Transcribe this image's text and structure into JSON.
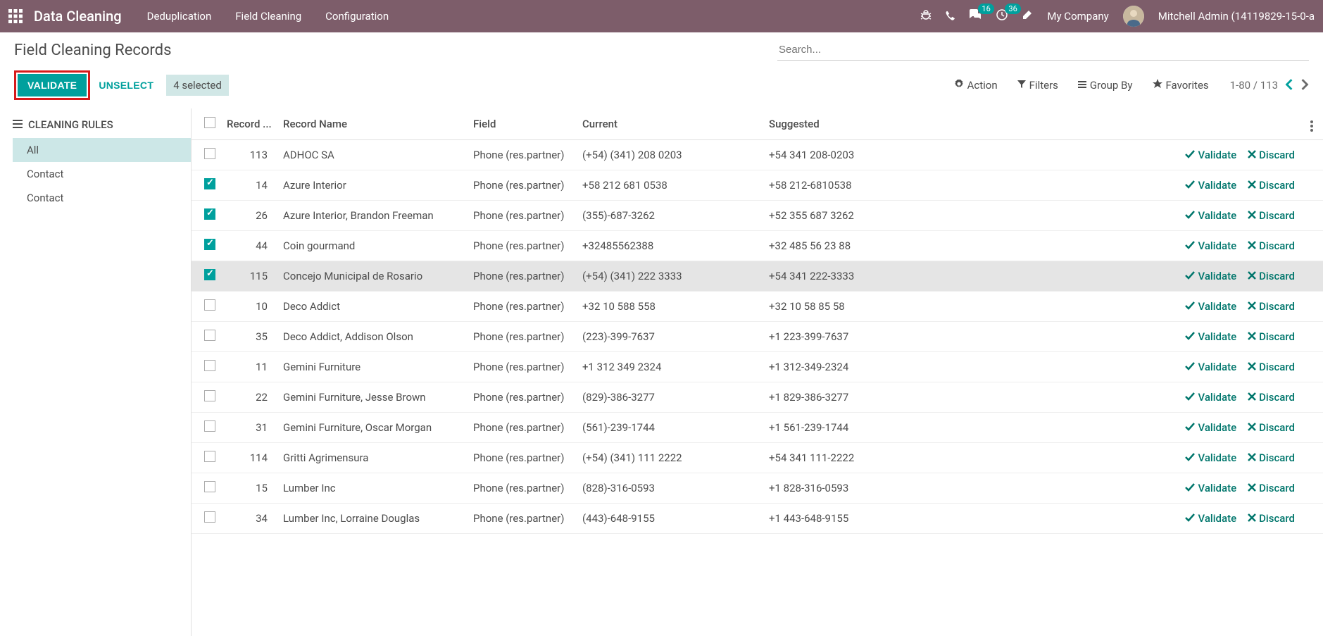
{
  "topbar": {
    "app_title": "Data Cleaning",
    "menu": [
      "Deduplication",
      "Field Cleaning",
      "Configuration"
    ],
    "conv_badge": "16",
    "activity_badge": "36",
    "company": "My Company",
    "username": "Mitchell Admin (14119829-15-0-a"
  },
  "control": {
    "title": "Field Cleaning Records",
    "search_placeholder": "Search...",
    "validate_label": "VALIDATE",
    "unselect_label": "UNSELECT",
    "selected_label": "4 selected",
    "action_label": "Action",
    "filters_label": "Filters",
    "groupby_label": "Group By",
    "favorites_label": "Favorites",
    "pager": "1-80 / 113"
  },
  "sidebar": {
    "header": "CLEANING RULES",
    "items": [
      "All",
      "Contact",
      "Contact"
    ]
  },
  "table": {
    "headers": {
      "record_id": "Record ...",
      "record_name": "Record Name",
      "field": "Field",
      "current": "Current",
      "suggested": "Suggested"
    },
    "validate_label": "Validate",
    "discard_label": "Discard",
    "rows": [
      {
        "checked": false,
        "id": "113",
        "name": "ADHOC SA",
        "field": "Phone (res.partner)",
        "current": "(+54) (341) 208 0203",
        "suggested": "+54 341 208-0203"
      },
      {
        "checked": true,
        "id": "14",
        "name": "Azure Interior",
        "field": "Phone (res.partner)",
        "current": "+58 212 681 0538",
        "suggested": "+58 212-6810538"
      },
      {
        "checked": true,
        "id": "26",
        "name": "Azure Interior, Brandon Freeman",
        "field": "Phone (res.partner)",
        "current": "(355)-687-3262",
        "suggested": "+52 355 687 3262"
      },
      {
        "checked": true,
        "id": "44",
        "name": "Coin gourmand",
        "field": "Phone (res.partner)",
        "current": "+32485562388",
        "suggested": "+32 485 56 23 88"
      },
      {
        "checked": true,
        "id": "115",
        "name": "Concejo Municipal de Rosario",
        "field": "Phone (res.partner)",
        "current": "(+54) (341) 222 3333",
        "suggested": "+54 341 222-3333",
        "hover": true
      },
      {
        "checked": false,
        "id": "10",
        "name": "Deco Addict",
        "field": "Phone (res.partner)",
        "current": "+32 10 588 558",
        "suggested": "+32 10 58 85 58"
      },
      {
        "checked": false,
        "id": "35",
        "name": "Deco Addict, Addison Olson",
        "field": "Phone (res.partner)",
        "current": "(223)-399-7637",
        "suggested": "+1 223-399-7637"
      },
      {
        "checked": false,
        "id": "11",
        "name": "Gemini Furniture",
        "field": "Phone (res.partner)",
        "current": "+1 312 349 2324",
        "suggested": "+1 312-349-2324"
      },
      {
        "checked": false,
        "id": "22",
        "name": "Gemini Furniture, Jesse Brown",
        "field": "Phone (res.partner)",
        "current": "(829)-386-3277",
        "suggested": "+1 829-386-3277"
      },
      {
        "checked": false,
        "id": "31",
        "name": "Gemini Furniture, Oscar Morgan",
        "field": "Phone (res.partner)",
        "current": "(561)-239-1744",
        "suggested": "+1 561-239-1744"
      },
      {
        "checked": false,
        "id": "114",
        "name": "Gritti Agrimensura",
        "field": "Phone (res.partner)",
        "current": "(+54) (341) 111 2222",
        "suggested": "+54 341 111-2222"
      },
      {
        "checked": false,
        "id": "15",
        "name": "Lumber Inc",
        "field": "Phone (res.partner)",
        "current": "(828)-316-0593",
        "suggested": "+1 828-316-0593"
      },
      {
        "checked": false,
        "id": "34",
        "name": "Lumber Inc, Lorraine Douglas",
        "field": "Phone (res.partner)",
        "current": "(443)-648-9155",
        "suggested": "+1 443-648-9155"
      }
    ]
  }
}
